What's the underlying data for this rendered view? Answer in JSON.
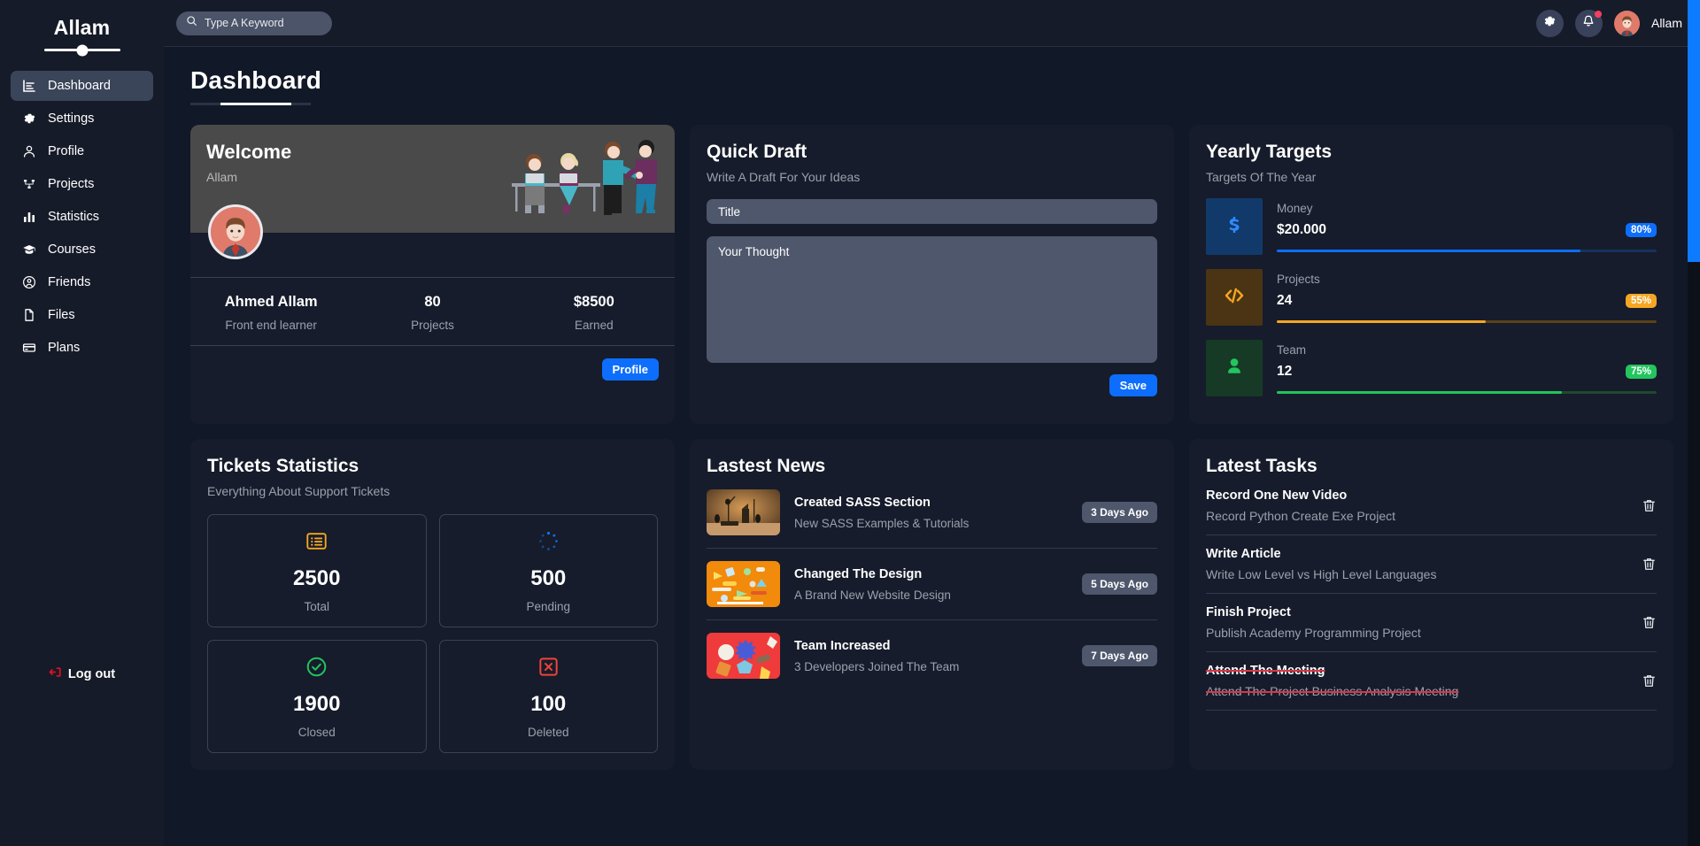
{
  "sidebar": {
    "brand": "Allam",
    "items": [
      {
        "label": "Dashboard",
        "icon": "chart-list-icon",
        "active": true
      },
      {
        "label": "Settings",
        "icon": "gear-icon",
        "active": false
      },
      {
        "label": "Profile",
        "icon": "user-icon",
        "active": false
      },
      {
        "label": "Projects",
        "icon": "sitemap-icon",
        "active": false
      },
      {
        "label": "Statistics",
        "icon": "bar-chart-icon",
        "active": false
      },
      {
        "label": "Courses",
        "icon": "graduation-cap-icon",
        "active": false
      },
      {
        "label": "Friends",
        "icon": "user-circle-icon",
        "active": false
      },
      {
        "label": "Files",
        "icon": "file-icon",
        "active": false
      },
      {
        "label": "Plans",
        "icon": "credit-card-icon",
        "active": false
      }
    ],
    "logout_label": "Log out",
    "logout_icon": "logout-arrow-icon",
    "logout_color": "#e01020"
  },
  "topbar": {
    "search_placeholder": "Type A Keyword",
    "search_value": "",
    "search_icon": "search-icon",
    "settings_icon": "gear-icon",
    "notification_icon": "bell-icon",
    "has_notification": true,
    "user_name": "Allam"
  },
  "page": {
    "title": "Dashboard"
  },
  "welcome": {
    "heading": "Welcome",
    "subheading": "Allam",
    "stats": [
      {
        "value": "Ahmed Allam",
        "label": "Front end learner"
      },
      {
        "value": "80",
        "label": "Projects"
      },
      {
        "value": "$8500",
        "label": "Earned"
      }
    ],
    "button_label": "Profile"
  },
  "quick_draft": {
    "title": "Quick Draft",
    "subtitle": "Write A Draft For Your Ideas",
    "title_placeholder": "Title",
    "title_value": "",
    "thought_placeholder": "Your Thought",
    "thought_value": "",
    "save_label": "Save"
  },
  "yearly_targets": {
    "title": "Yearly Targets",
    "subtitle": "Targets Of The Year",
    "rows": [
      {
        "label": "Money",
        "value": "$20.000",
        "percent": "80%",
        "pct_num": 80,
        "icon": "dollar-icon",
        "accent": "#0d6efd",
        "tile_bg": "#113a6b",
        "track_bg": "#16335c"
      },
      {
        "label": "Projects",
        "value": "24",
        "percent": "55%",
        "pct_num": 55,
        "icon": "code-icon",
        "accent": "#f5a623",
        "tile_bg": "#4a3413",
        "track_bg": "#5b4117"
      },
      {
        "label": "Team",
        "value": "12",
        "percent": "75%",
        "pct_num": 75,
        "icon": "user-solid-icon",
        "accent": "#22c55e",
        "tile_bg": "#163a26",
        "track_bg": "#1d4a2f"
      }
    ]
  },
  "tickets": {
    "title": "Tickets Statistics",
    "subtitle": "Everything About Support Tickets",
    "boxes": [
      {
        "number": "2500",
        "label": "Total",
        "icon": "list-box-icon",
        "color": "#f5a623"
      },
      {
        "number": "500",
        "label": "Pending",
        "icon": "spinner-icon",
        "color": "#0d7bff"
      },
      {
        "number": "1900",
        "label": "Closed",
        "icon": "check-circle-icon",
        "color": "#22c55e"
      },
      {
        "number": "100",
        "label": "Deleted",
        "icon": "x-square-icon",
        "color": "#f04438"
      }
    ]
  },
  "news": {
    "title": "Lastest News",
    "items": [
      {
        "heading": "Created SASS Section",
        "sub": "New SASS Examples & Tutorials",
        "time": "3 Days Ago",
        "thumb": "desk-lamp-photo"
      },
      {
        "heading": "Changed The Design",
        "sub": "A Brand New Website Design",
        "time": "5 Days Ago",
        "thumb": "orange-stationery-photo"
      },
      {
        "heading": "Team Increased",
        "sub": "3 Developers Joined The Team",
        "time": "7 Days Ago",
        "thumb": "red-shapes-photo"
      }
    ]
  },
  "tasks": {
    "title": "Latest Tasks",
    "delete_icon": "trash-icon",
    "items": [
      {
        "heading": "Record One New Video",
        "sub": "Record Python Create Exe Project",
        "done": false
      },
      {
        "heading": "Write Article",
        "sub": "Write Low Level vs High Level Languages",
        "done": false
      },
      {
        "heading": "Finish Project",
        "sub": "Publish Academy Programming Project",
        "done": false
      },
      {
        "heading": "Attend The Meeting",
        "sub": "Attend The Project Business Analysis Meeting",
        "done": true
      }
    ]
  },
  "colors": {
    "page_bg": "#111827",
    "card_bg": "#161c2b",
    "sidebar_bg": "#161b29",
    "accent_blue": "#0d6efd",
    "scrollbar": "#0d7bff"
  }
}
